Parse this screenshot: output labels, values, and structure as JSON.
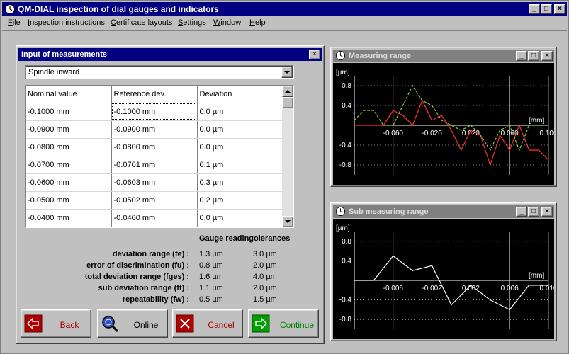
{
  "app": {
    "title": "QM-DIAL inspection of dial gauges and indicators",
    "window_buttons": {
      "minimize": "_",
      "maximize": "□",
      "close": "×"
    }
  },
  "menu": {
    "items": [
      {
        "label": "File",
        "accel": "F",
        "rest": "ile"
      },
      {
        "label": "Inspection instructions",
        "accel": "I",
        "rest": "nspection instructions"
      },
      {
        "label": "Certificate layouts",
        "accel": "C",
        "rest": "ertificate layouts"
      },
      {
        "label": "Settings",
        "accel": "S",
        "rest": "ettings"
      },
      {
        "label": "Window",
        "accel": "W",
        "rest": "indow"
      },
      {
        "label": "Help",
        "accel": "H",
        "rest": "elp"
      }
    ]
  },
  "input_window": {
    "title": "Input of measurements",
    "mode_select": {
      "value": "Spindle inward"
    },
    "columns": [
      "Nominal value",
      "Reference dev.",
      "Deviation"
    ],
    "rows": [
      [
        "-0.1000 mm",
        "-0.1000 mm",
        "0.0 µm"
      ],
      [
        "-0.0900 mm",
        "-0.0900 mm",
        "0.0 µm"
      ],
      [
        "-0.0800 mm",
        "-0.0800 mm",
        "0.0 µm"
      ],
      [
        "-0.0700 mm",
        "-0.0701 mm",
        "0.1 µm"
      ],
      [
        "-0.0600 mm",
        "-0.0603 mm",
        "0.3 µm"
      ],
      [
        "-0.0500 mm",
        "-0.0502 mm",
        "0.2 µm"
      ],
      [
        "-0.0400 mm",
        "-0.0400 mm",
        "0.0 µm"
      ]
    ],
    "stats_header": "Gauge readingolerances",
    "stats": [
      {
        "label": "deviation range (fe) :",
        "reading": "1.3 µm",
        "tolerance": "3.0 µm"
      },
      {
        "label": "error of discrimination (fu) :",
        "reading": "0.8 µm",
        "tolerance": "2.0 µm"
      },
      {
        "label": "total deviation range (fges) :",
        "reading": "1.6 µm",
        "tolerance": "4.0 µm"
      },
      {
        "label": "sub deviation range (ft) :",
        "reading": "1.1 µm",
        "tolerance": "2.0 µm"
      },
      {
        "label": "repeatability (fw) :",
        "reading": "0.5 µm",
        "tolerance": "1.5 µm"
      }
    ],
    "buttons": {
      "back": "Back",
      "online": "Online",
      "cancel": "Cancel",
      "continue": "Continue"
    }
  },
  "colors": {
    "title_active": "#000080",
    "title_inactive": "#808080",
    "series_red": "#ff3030",
    "series_green": "#7fd04a",
    "series_white": "#ffffff"
  },
  "chart_data": [
    {
      "window_title": "Measuring range",
      "type": "line",
      "ylabel": "[µm]",
      "xlabel": "[mm]",
      "ylim": [
        -1.0,
        1.0
      ],
      "xlim": [
        -0.1,
        0.1
      ],
      "yticks": [
        0.8,
        0.4,
        -0.4,
        -0.8
      ],
      "ytick_labels": [
        "0.8",
        "0.4",
        "-0.4",
        "-0.8"
      ],
      "xticks": [
        -0.06,
        -0.02,
        0.02,
        0.06,
        0.1
      ],
      "xtick_labels": [
        "-0.060",
        "-0.020",
        "0.020",
        "0.060",
        "0.100"
      ],
      "grid": true,
      "series": [
        {
          "color": "#ff3030",
          "x": [
            -0.1,
            -0.09,
            -0.08,
            -0.07,
            -0.06,
            -0.05,
            -0.04,
            -0.03,
            -0.02,
            -0.01,
            0.0,
            0.01,
            0.02,
            0.03,
            0.04,
            0.05,
            0.06,
            0.07,
            0.08,
            0.09,
            0.1
          ],
          "y": [
            0.0,
            0.0,
            0.0,
            0.0,
            0.3,
            0.2,
            0.0,
            0.5,
            0.1,
            0.2,
            -0.1,
            -0.5,
            -0.1,
            -0.2,
            -0.8,
            -0.2,
            -0.5,
            0.0,
            -0.5,
            -0.5,
            -0.7
          ]
        },
        {
          "color": "#7fd04a",
          "dashed": true,
          "x": [
            -0.1,
            -0.09,
            -0.08,
            -0.07,
            -0.06,
            -0.05,
            -0.04,
            -0.03,
            -0.02,
            -0.01,
            0.0,
            0.01,
            0.02,
            0.03,
            0.04,
            0.05,
            0.06,
            0.07,
            0.08,
            0.09,
            0.1
          ],
          "y": [
            0.1,
            0.3,
            0.3,
            0.0,
            0.0,
            0.4,
            0.8,
            0.5,
            0.4,
            0.1,
            0.0,
            -0.1,
            0.0,
            -0.2,
            -0.5,
            -0.1,
            0.0,
            -0.5,
            0.0,
            0.0,
            0.0
          ]
        }
      ]
    },
    {
      "window_title": "Sub measuring range",
      "type": "line",
      "ylabel": "[µm]",
      "xlabel": "[mm]",
      "ylim": [
        -1.0,
        1.0
      ],
      "xlim": [
        -0.01,
        0.01
      ],
      "yticks": [
        0.8,
        0.4,
        -0.4,
        -0.8
      ],
      "ytick_labels": [
        "0.8",
        "0.4",
        "-0.4",
        "-0.8"
      ],
      "xticks": [
        -0.006,
        -0.002,
        0.002,
        0.006,
        0.01
      ],
      "xtick_labels": [
        "-0.006",
        "-0.002",
        "0.002",
        "0.006",
        "0.010"
      ],
      "grid": true,
      "series": [
        {
          "color": "#ffffff",
          "x": [
            -0.01,
            -0.008,
            -0.006,
            -0.004,
            -0.002,
            0.0,
            0.002,
            0.004,
            0.006,
            0.008,
            0.01
          ],
          "y": [
            0.0,
            0.0,
            0.5,
            0.2,
            0.3,
            -0.5,
            -0.1,
            -0.4,
            -0.6,
            -0.1,
            -0.1
          ]
        }
      ]
    }
  ]
}
